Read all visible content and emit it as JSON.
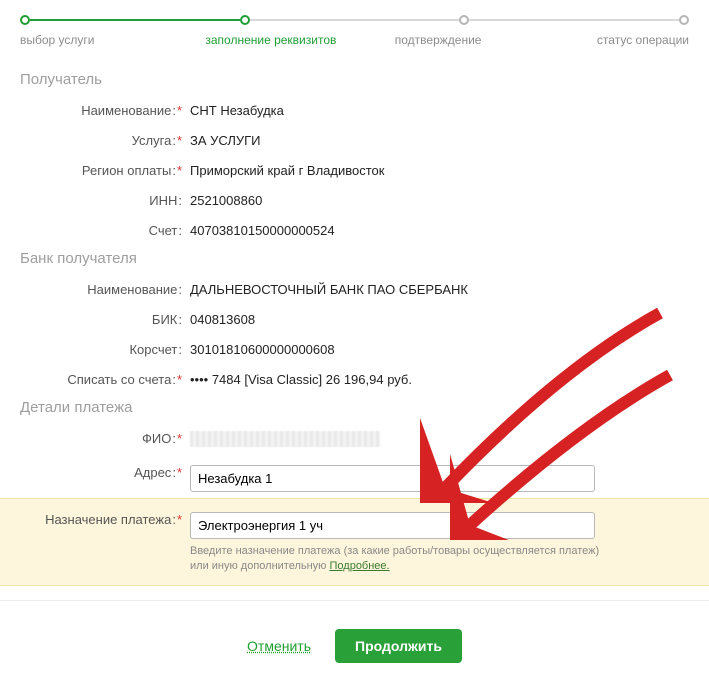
{
  "stepper": {
    "steps": [
      "выбор услуги",
      "заполнение реквизитов",
      "подтверждение",
      "статус операции"
    ],
    "active_index": 1
  },
  "recipient": {
    "section_title": "Получатель",
    "rows": {
      "name": {
        "label": "Наименование",
        "value": "СНТ Незабудка",
        "required": true
      },
      "service": {
        "label": "Услуга",
        "value": "ЗА УСЛУГИ",
        "required": true
      },
      "region": {
        "label": "Регион оплаты",
        "value": "Приморский край г Владивосток",
        "required": true
      },
      "inn": {
        "label": "ИНН",
        "value": "2521008860",
        "required": false
      },
      "account": {
        "label": "Счет",
        "value": "40703810150000000524",
        "required": false
      }
    }
  },
  "bank": {
    "section_title": "Банк получателя",
    "rows": {
      "name": {
        "label": "Наименование",
        "value": "ДАЛЬНЕВОСТОЧНЫЙ БАНК ПАО СБЕРБАНК",
        "required": false
      },
      "bik": {
        "label": "БИК",
        "value": "040813608",
        "required": false
      },
      "kor": {
        "label": "Корсчет",
        "value": "30101810600000000608",
        "required": false
      },
      "from": {
        "label": "Списать со счета",
        "value": "•••• 7484  [Visa Classic] 26 196,94  руб.",
        "required": true
      }
    }
  },
  "details": {
    "section_title": "Детали платежа",
    "fio": {
      "label": "ФИО",
      "required": true
    },
    "address": {
      "label": "Адрес",
      "value": "Незабудка 1",
      "required": true
    },
    "purpose": {
      "label": "Назначение платежа",
      "value": "Электроэнергия 1 уч",
      "required": true,
      "hint_prefix": "Введите назначение платежа (за какие работы/товары осуществляется платеж) или иную дополнительную ",
      "hint_link": "Подробнее."
    }
  },
  "actions": {
    "cancel": "Отменить",
    "continue": "Продолжить"
  }
}
